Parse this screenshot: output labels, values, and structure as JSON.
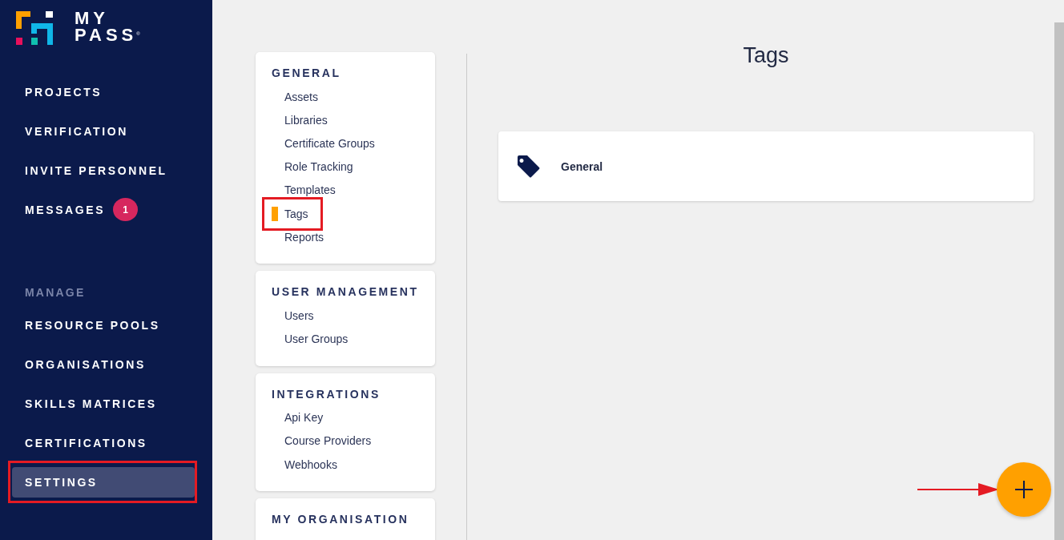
{
  "logo": {
    "lines": [
      "MY",
      "PASS"
    ],
    "mark": "®"
  },
  "sidebar": {
    "items": [
      {
        "label": "PROJECTS",
        "selected": false
      },
      {
        "label": "VERIFICATION",
        "selected": false
      },
      {
        "label": "INVITE PERSONNEL",
        "selected": false
      },
      {
        "label": "MESSAGES",
        "selected": false,
        "badge": "1"
      }
    ],
    "section_label": "MANAGE",
    "manage_items": [
      {
        "label": "RESOURCE POOLS",
        "selected": false,
        "annotated": false
      },
      {
        "label": "ORGANISATIONS",
        "selected": false,
        "annotated": false
      },
      {
        "label": "SKILLS MATRICES",
        "selected": false,
        "annotated": false
      },
      {
        "label": "CERTIFICATIONS",
        "selected": false,
        "annotated": false
      },
      {
        "label": "SETTINGS",
        "selected": true,
        "annotated": true
      }
    ]
  },
  "settings_menu": [
    {
      "heading": "GENERAL",
      "items": [
        {
          "label": "Assets",
          "selected": false,
          "annotated": false
        },
        {
          "label": "Libraries",
          "selected": false,
          "annotated": false
        },
        {
          "label": "Certificate Groups",
          "selected": false,
          "annotated": false
        },
        {
          "label": "Role Tracking",
          "selected": false,
          "annotated": false
        },
        {
          "label": "Templates",
          "selected": false,
          "annotated": false
        },
        {
          "label": "Tags",
          "selected": true,
          "annotated": true
        },
        {
          "label": "Reports",
          "selected": false,
          "annotated": false
        }
      ]
    },
    {
      "heading": "USER MANAGEMENT",
      "items": [
        {
          "label": "Users",
          "selected": false,
          "annotated": false
        },
        {
          "label": "User Groups",
          "selected": false,
          "annotated": false
        }
      ]
    },
    {
      "heading": "INTEGRATIONS",
      "items": [
        {
          "label": "Api Key",
          "selected": false,
          "annotated": false
        },
        {
          "label": "Course Providers",
          "selected": false,
          "annotated": false
        },
        {
          "label": "Webhooks",
          "selected": false,
          "annotated": false
        }
      ]
    },
    {
      "heading": "MY ORGANISATION"
    }
  ],
  "page": {
    "title": "Tags",
    "tags": [
      {
        "name": "General"
      }
    ]
  },
  "add_button": {
    "arrow_annotation": true
  }
}
